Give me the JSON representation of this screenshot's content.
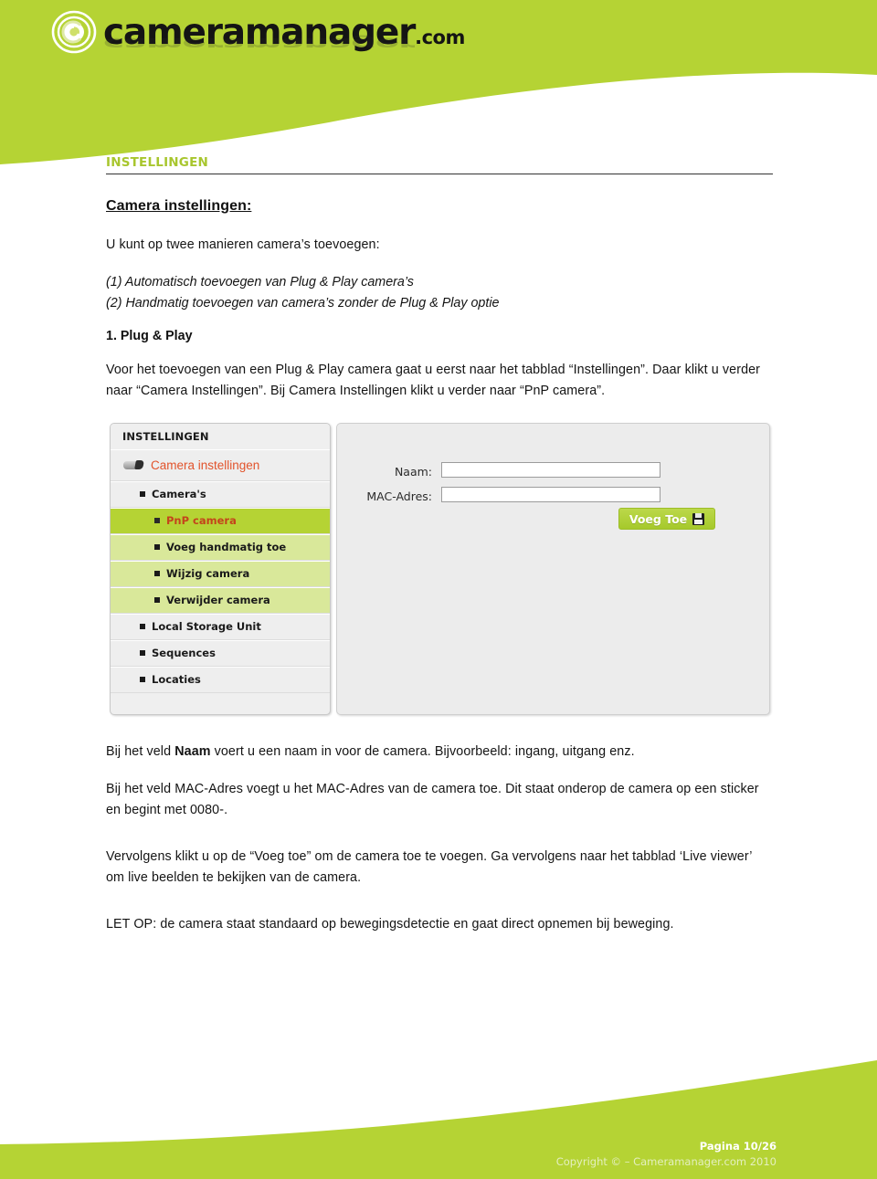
{
  "brand": {
    "logo_text": "cameramanager",
    "logo_domain": ".com",
    "green": "#b5d334",
    "heading_green": "#a8c62e",
    "accent_orange": "#e2532b"
  },
  "document": {
    "section_label": "INSTELLINGEN",
    "sub_heading": "Camera instellingen:",
    "intro": "U kunt op twee manieren camera’s toevoegen:",
    "options": [
      "(1) Automatisch toevoegen van Plug & Play camera’s",
      "(2) Handmatig toevoegen van camera’s zonder de Plug & Play optie"
    ],
    "numbered_heading": "1. Plug & Play",
    "paragraph_intro": "Voor het toevoegen van een Plug & Play camera gaat u eerst naar het tabblad “Instellingen”. Daar klikt u verder naar “Camera Instellingen”. Bij Camera Instellingen klikt u verder naar “PnP camera”.",
    "paragraph_naam_pre": "Bij het veld ",
    "paragraph_naam_bold": "Naam",
    "paragraph_naam_post": " voert u een naam in voor de camera. Bijvoorbeeld: ingang, uitgang enz.",
    "paragraph_mac": "Bij het veld MAC-Adres voegt u het MAC-Adres van de camera toe. Dit staat onderop de camera op een sticker en begint met 0080-.",
    "paragraph_voegtoe": "Vervolgens klikt u op de “Voeg toe” om de camera toe te voegen. Ga vervolgens naar het tabblad ‘Live viewer’ om live beelden te bekijken van de camera.",
    "paragraph_letop": "LET OP: de camera staat standaard op bewegingsdetectie en gaat direct opnemen bij beweging."
  },
  "screenshot": {
    "sidebar": {
      "title": "INSTELLINGEN",
      "header_item": {
        "label": "Camera instellingen",
        "icon": "camera-icon"
      },
      "items": [
        {
          "label": "Camera's",
          "level": 1,
          "state": "normal"
        },
        {
          "label": "PnP camera",
          "level": 2,
          "state": "selected"
        },
        {
          "label": "Voeg handmatig toe",
          "level": 2,
          "state": "highlight"
        },
        {
          "label": "Wijzig camera",
          "level": 2,
          "state": "highlight"
        },
        {
          "label": "Verwijder camera",
          "level": 2,
          "state": "highlight"
        },
        {
          "label": "Local Storage Unit",
          "level": 1,
          "state": "normal"
        },
        {
          "label": "Sequences",
          "level": 1,
          "state": "normal"
        },
        {
          "label": "Locaties",
          "level": 1,
          "state": "normal"
        }
      ]
    },
    "panel": {
      "fields": [
        {
          "label": "Naam:",
          "value": "",
          "placeholder": ""
        },
        {
          "label": "MAC-Adres:",
          "value": "",
          "placeholder": ""
        }
      ],
      "submit_button": {
        "label": "Voeg Toe",
        "icon": "floppy-disk-icon"
      }
    }
  },
  "footer": {
    "page_label": "Pagina 10/26",
    "copyright": "Copyright © – Cameramanager.com 2010"
  }
}
